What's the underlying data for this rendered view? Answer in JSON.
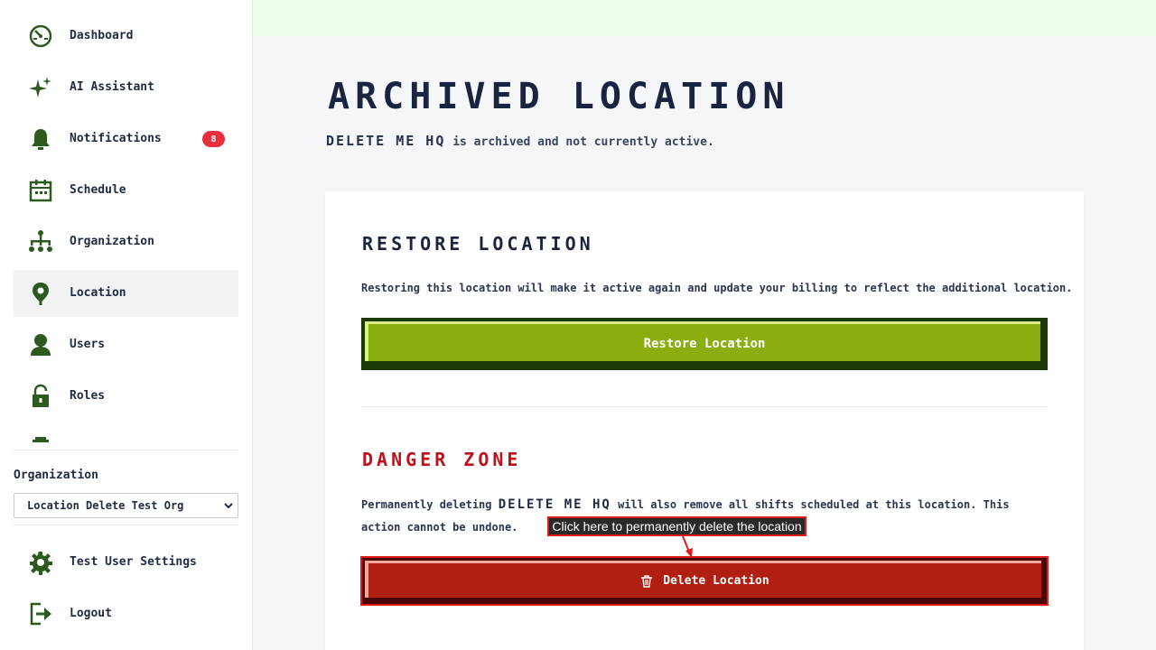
{
  "sidebar": {
    "items": [
      {
        "label": "Dashboard",
        "icon": "dashboard-icon"
      },
      {
        "label": "AI Assistant",
        "icon": "sparkle-icon"
      },
      {
        "label": "Notifications",
        "icon": "bell-icon",
        "badge": "8"
      },
      {
        "label": "Schedule",
        "icon": "calendar-icon"
      },
      {
        "label": "Organization",
        "icon": "org-chart-icon"
      },
      {
        "label": "Location",
        "icon": "location-pin-icon",
        "active": true
      },
      {
        "label": "Users",
        "icon": "user-icon"
      },
      {
        "label": "Roles",
        "icon": "lock-icon"
      }
    ],
    "org_label": "Organization",
    "org_select_value": "Location Delete Test Org",
    "settings_label": "Test User Settings",
    "logout_label": "Logout"
  },
  "main": {
    "title": "ARCHIVED LOCATION",
    "subtitle_name": "DELETE ME HQ",
    "subtitle_rest": " is archived and not currently active.",
    "restore": {
      "title": "RESTORE LOCATION",
      "text": "Restoring this location will make it active again and update your billing to reflect the additional location.",
      "button_label": "Restore Location"
    },
    "danger": {
      "title": "DANGER ZONE",
      "text_pre": "Permanently deleting ",
      "text_name": "DELETE ME HQ",
      "text_post": " will also remove all shifts scheduled at this location. This",
      "text_line2": "action cannot be undone.",
      "button_label": "Delete Location"
    },
    "tooltip": "Click here to permanently delete the location"
  },
  "colors": {
    "icon_green": "#2d5a1e",
    "restore_green": "#8aad10",
    "delete_red": "#b01f12",
    "danger_title": "#c0101a",
    "badge_red": "#e8303d",
    "topbar": "#ecfde8"
  }
}
